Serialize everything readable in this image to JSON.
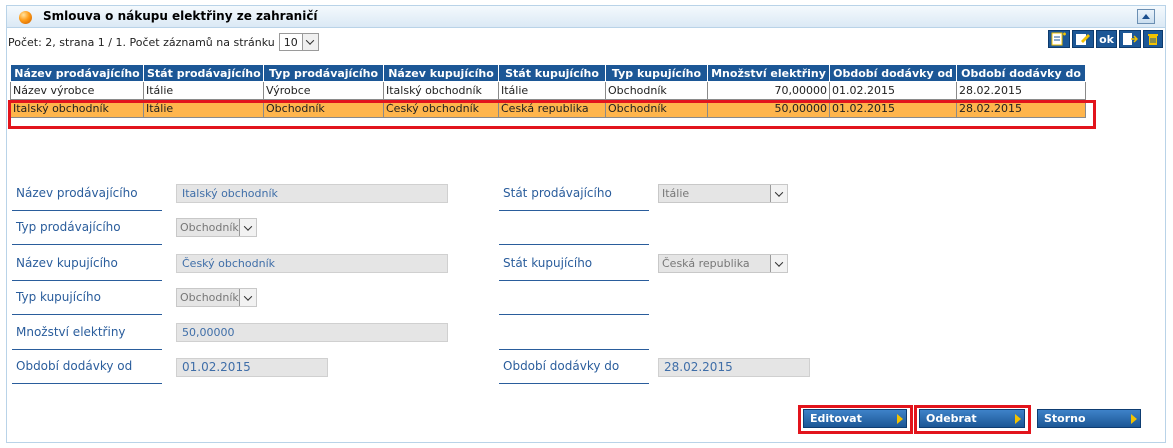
{
  "panel": {
    "title": "Smlouva o nákupu elektřiny ze zahraničí"
  },
  "pager": {
    "text": "Počet: 2, strana 1 / 1. Počet záznamů na stránku",
    "page_size": "10"
  },
  "toolbar": {
    "ok_label": "ok"
  },
  "grid": {
    "columns": [
      "Název prodávajícího",
      "Stát prodávajícího",
      "Typ prodávajícího",
      "Název kupujícího",
      "Stát kupujícího",
      "Typ kupujícího",
      "Množství elektřiny",
      "Období dodávky od",
      "Období dodávky do"
    ],
    "rows": [
      [
        "Název výrobce",
        "Itálie",
        "Výrobce",
        "Italský obchodník",
        "Itálie",
        "Obchodník",
        "70,00000",
        "01.02.2015",
        "28.02.2015"
      ],
      [
        "Italský obchodník",
        "Itálie",
        "Obchodník",
        "Český obchodník",
        "Česká republika",
        "Obchodník",
        "50,00000",
        "01.02.2015",
        "28.02.2015"
      ]
    ],
    "selected_row": 1
  },
  "form": {
    "seller_name_label": "Název prodávajícího",
    "seller_name_value": "Italský obchodník",
    "seller_country_label": "Stát prodávajícího",
    "seller_country_value": "Itálie",
    "seller_type_label": "Typ prodávajícího",
    "seller_type_value": "Obchodník",
    "buyer_name_label": "Název kupujícího",
    "buyer_name_value": "Český obchodník",
    "buyer_country_label": "Stát kupujícího",
    "buyer_country_value": "Česká republika",
    "buyer_type_label": "Typ kupujícího",
    "buyer_type_value": "Obchodník",
    "amount_label": "Množství elektřiny",
    "amount_value": "50,00000",
    "period_from_label": "Období dodávky od",
    "period_from_value": "01.02.2015",
    "period_to_label": "Období dodávky do",
    "period_to_value": "28.02.2015"
  },
  "actions": {
    "edit_label": "Editovat",
    "remove_label": "Odebrat",
    "cancel_label": "Storno"
  },
  "colors": {
    "header_blue": "#1c5796",
    "selected_row": "#ffb54c",
    "highlight_red": "#e2141c",
    "label_blue": "#2a5d9c"
  }
}
